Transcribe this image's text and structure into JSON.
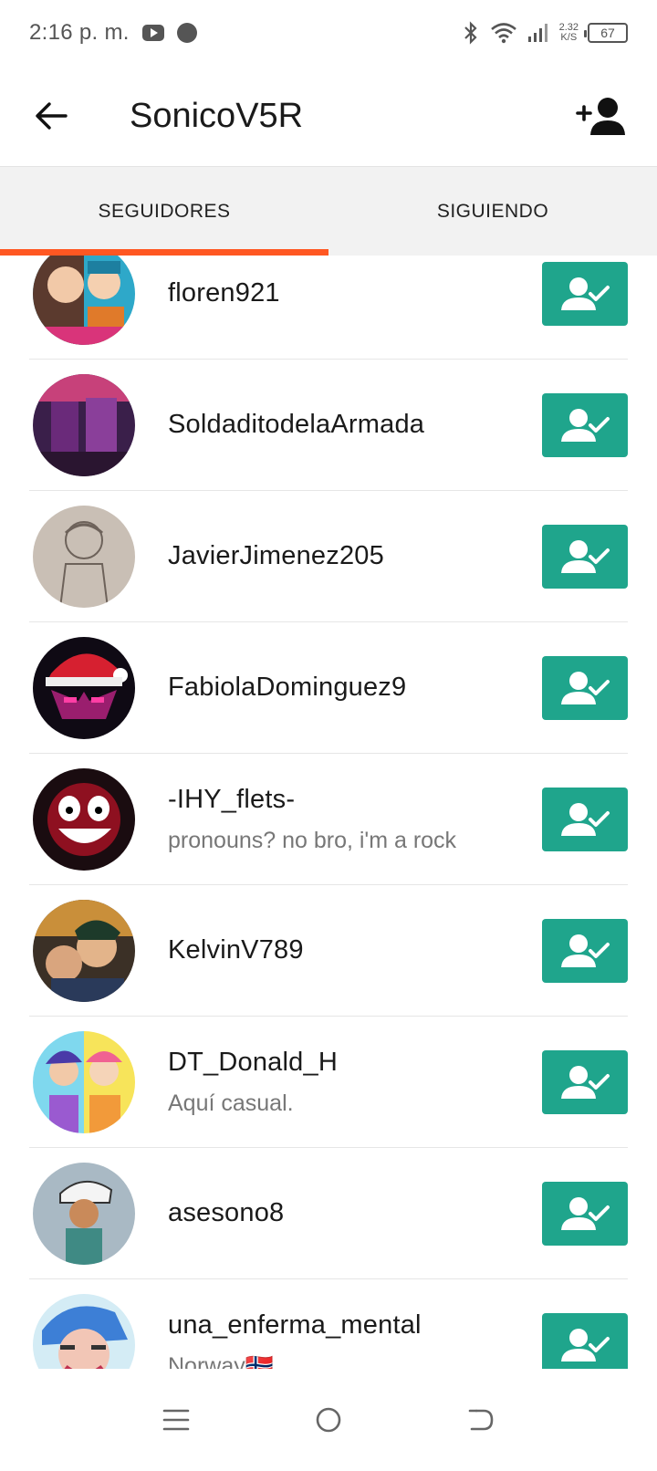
{
  "status_bar": {
    "time": "2:16 p. m.",
    "net_speed_value": "2.32",
    "net_speed_unit": "K/S",
    "battery": "67"
  },
  "app_bar": {
    "title": "SonicoV5R",
    "back_icon": "arrow-left-icon",
    "action_icon": "add-user-icon"
  },
  "tabs": [
    {
      "label": "SEGUIDORES",
      "active": true
    },
    {
      "label": "SIGUIENDO",
      "active": false
    }
  ],
  "colors": {
    "accent": "#ff5722",
    "follow_button": "#1fa58c"
  },
  "followers": [
    {
      "username": "floren921",
      "bio": ""
    },
    {
      "username": "SoldaditodelaArmada",
      "bio": ""
    },
    {
      "username": "JavierJimenez205",
      "bio": ""
    },
    {
      "username": "FabiolaDominguez9",
      "bio": ""
    },
    {
      "username": "-IHY_flets-",
      "bio": "pronouns? no bro, i'm a rock"
    },
    {
      "username": "KelvinV789",
      "bio": ""
    },
    {
      "username": "DT_Donald_H",
      "bio": "Aquí casual."
    },
    {
      "username": "asesono8",
      "bio": ""
    },
    {
      "username": "una_enferma_mental",
      "bio": "Norway🇳🇴"
    }
  ],
  "nav_bar": {
    "items": [
      "menu-icon",
      "home-icon",
      "back-icon"
    ]
  }
}
